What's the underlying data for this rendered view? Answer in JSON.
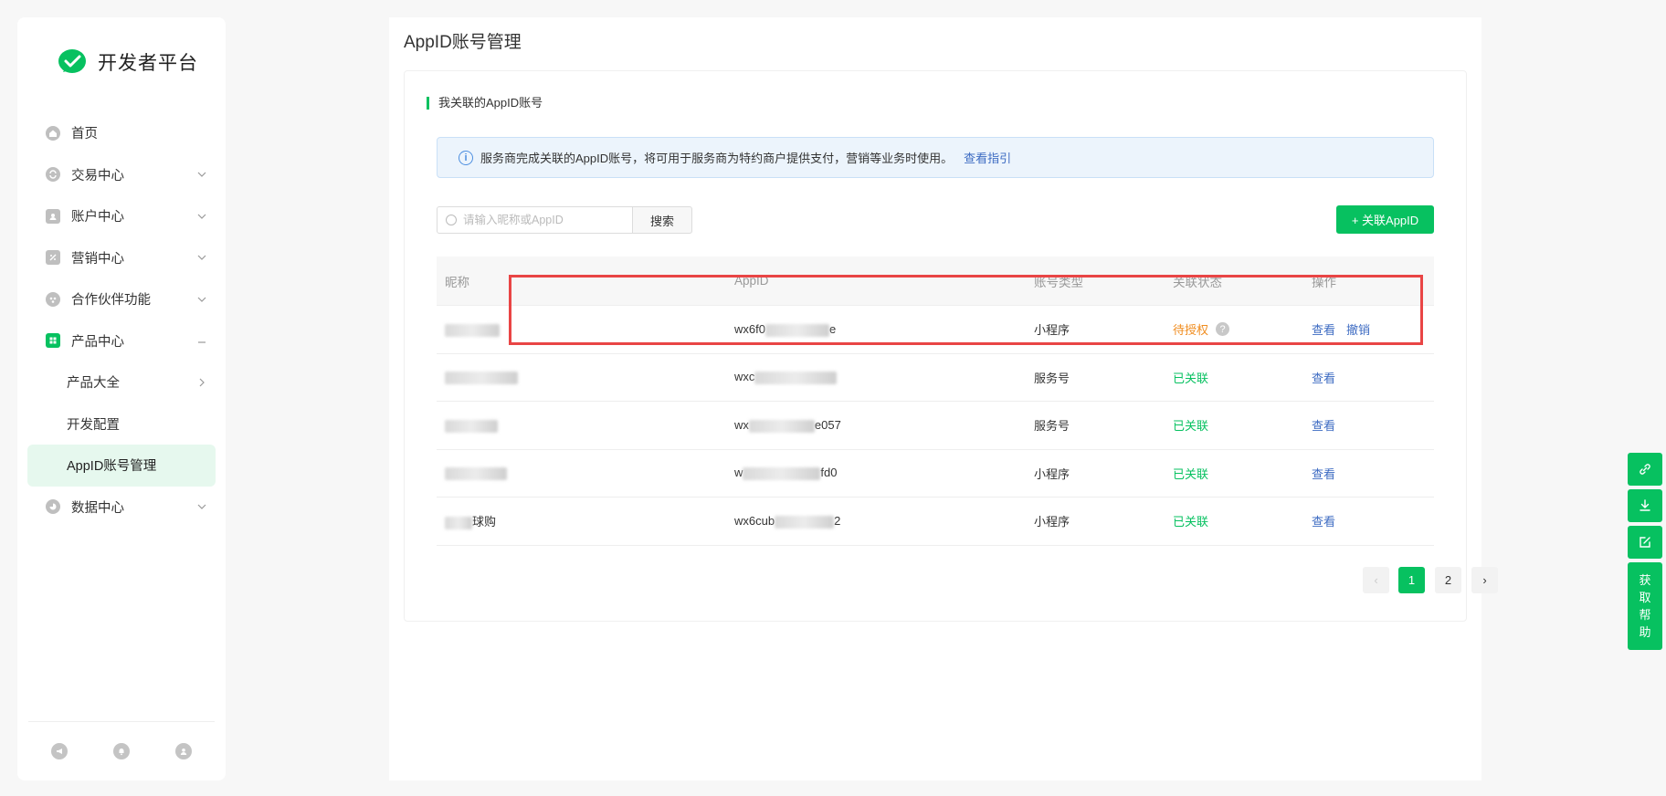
{
  "app": {
    "logo_text": "开发者平台",
    "brand_color": "#07c160"
  },
  "sidebar": {
    "items": [
      {
        "label": "首页",
        "icon": "home-icon"
      },
      {
        "label": "交易中心",
        "icon": "exchange-icon"
      },
      {
        "label": "账户中心",
        "icon": "account-icon"
      },
      {
        "label": "营销中心",
        "icon": "coupon-icon"
      },
      {
        "label": "合作伙伴功能",
        "icon": "partner-icon"
      },
      {
        "label": "产品中心",
        "icon": "apps-icon"
      },
      {
        "label": "数据中心",
        "icon": "chart-icon"
      }
    ],
    "sub_items": [
      {
        "label": "产品大全"
      },
      {
        "label": "开发配置"
      },
      {
        "label": "AppID账号管理"
      }
    ],
    "footer_icons": [
      "megaphone-icon",
      "bell-icon",
      "user-icon"
    ]
  },
  "page": {
    "title": "AppID账号管理",
    "section_title": "我关联的AppID账号",
    "notice_text": "服务商完成关联的AppID账号，将可用于服务商为特约商户提供支付，营销等业务时使用。",
    "notice_link": "查看指引",
    "search_placeholder": "请输入昵称或AppID",
    "search_button": "搜索",
    "add_button": "+ 关联AppID"
  },
  "table": {
    "headers": [
      "昵称",
      "AppID",
      "账号类型",
      "关联状态",
      "操作"
    ],
    "rows": [
      {
        "appid": "wx6f0",
        "appid_tail": "e",
        "type": "小程序",
        "status": "待授权",
        "status_kind": "pending",
        "actions": [
          "查看",
          "撤销"
        ]
      },
      {
        "appid": "wxc",
        "appid_tail": "",
        "type": "服务号",
        "status": "已关联",
        "status_kind": "ok",
        "actions": [
          "查看"
        ]
      },
      {
        "appid": "wx",
        "appid_tail": "e057",
        "type": "服务号",
        "status": "已关联",
        "status_kind": "ok",
        "actions": [
          "查看"
        ]
      },
      {
        "appid": "w",
        "appid_tail": "fd0",
        "type": "小程序",
        "status": "已关联",
        "status_kind": "ok",
        "actions": [
          "查看"
        ]
      },
      {
        "nickname_tail": "球购",
        "appid": "wx6cub",
        "appid_tail": "2",
        "type": "小程序",
        "status": "已关联",
        "status_kind": "ok",
        "actions": [
          "查看"
        ]
      }
    ]
  },
  "pagination": {
    "pages": [
      "1",
      "2"
    ],
    "current": "1"
  },
  "float_tools": {
    "help_label": [
      "获",
      "取",
      "帮",
      "助"
    ]
  }
}
